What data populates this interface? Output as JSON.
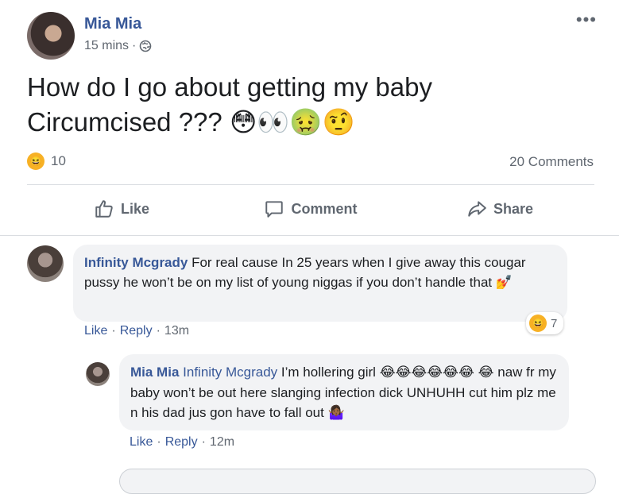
{
  "post": {
    "author": "Mia Mia",
    "time": "15 mins",
    "separator": "·",
    "text": "How do I go about getting my baby Circumcised ???",
    "emojis": "😳👀🤢🤨",
    "reaction_count": "10",
    "comments_count": "20 Comments"
  },
  "actions": {
    "like": "Like",
    "comment": "Comment",
    "share": "Share"
  },
  "comments": [
    {
      "author": "Infinity Mcgrady",
      "text": "For real cause In 25 years when I give away this cougar pussy he won’t be on my list of young niggas if you don’t handle that",
      "emoji": "💅",
      "like": "Like",
      "reply": "Reply",
      "time": "13m",
      "reaction_count": "7"
    }
  ],
  "reply": {
    "author": "Mia Mia",
    "tag": "Infinity Mcgrady",
    "text_a": "I’m hollering girl",
    "emojis_a": "😂😂😂😂😂😂",
    "emoji_b": "😂",
    "text_b": "naw fr my baby won’t be out here slanging infection dick UNHUHH cut him plz me n his dad jus gon have to fall out",
    "emoji_c": "🤷🏾‍♀️",
    "like": "Like",
    "reply": "Reply",
    "time": "12m"
  },
  "colors": {
    "link": "#385898",
    "meta": "#606770",
    "bubble": "#f2f3f5"
  }
}
